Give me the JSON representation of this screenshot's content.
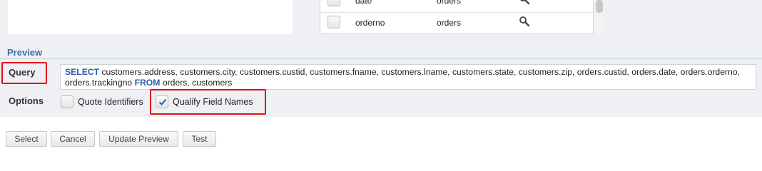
{
  "fields_list": {
    "rows": [
      {
        "name": "date",
        "table": "orders",
        "icon": "magnifier-icon"
      },
      {
        "name": "orderno",
        "table": "orders",
        "icon": "magnifier-icon"
      }
    ]
  },
  "preview": {
    "section_title": "Preview",
    "query_label": "Query",
    "query": {
      "select_keyword": "SELECT",
      "columns_text": " customers.address, customers.city, customers.custid, customers.fname, customers.lname, customers.state, customers.zip, orders.custid, orders.date, orders.orderno, orders.trackingno ",
      "from_keyword": "FROM",
      "tables_text": " orders, customers"
    },
    "options_label": "Options",
    "options": [
      {
        "label": "Quote Identifiers",
        "checked": false
      },
      {
        "label": "Qualify Field Names",
        "checked": true
      }
    ]
  },
  "buttons": {
    "select": "Select",
    "cancel": "Cancel",
    "update_preview": "Update Preview",
    "test": "Test"
  },
  "colors": {
    "highlight": "#e01010",
    "keyword": "#2b5ea7",
    "section_title": "#3b6ea0"
  }
}
